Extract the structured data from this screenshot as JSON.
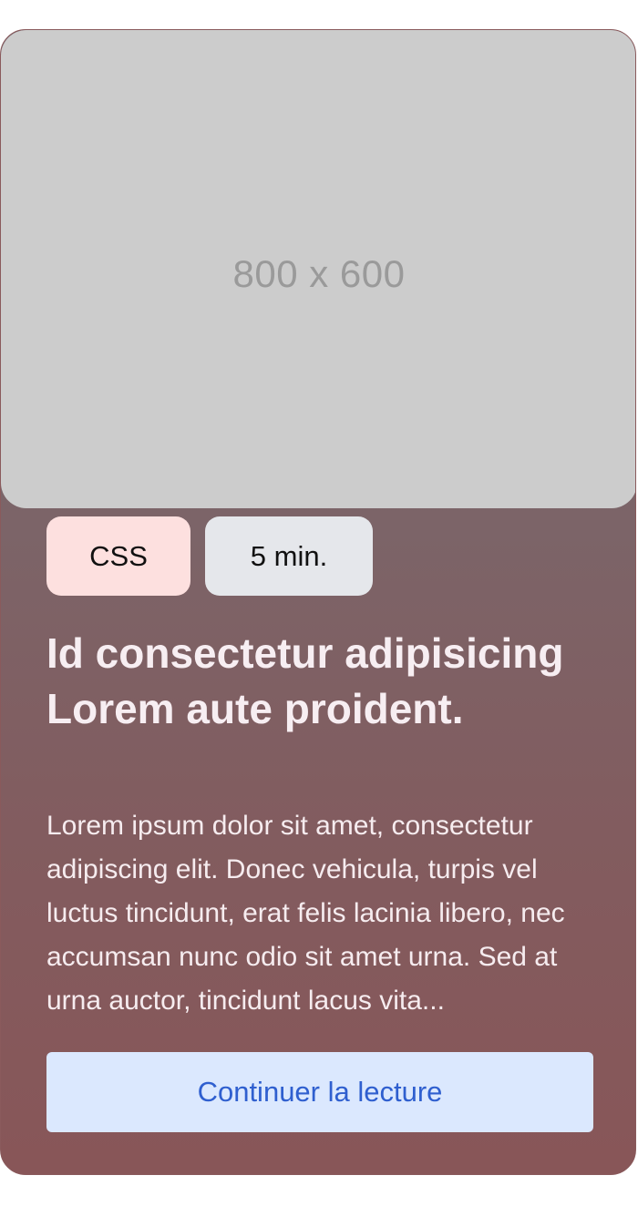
{
  "card": {
    "image_placeholder": "800 x 600",
    "tags": {
      "topic": "CSS",
      "duration": "5 min."
    },
    "title": "Id consectetur adipisicing Lorem aute proident.",
    "excerpt": "Lorem ipsum dolor sit amet, consectetur adipiscing elit. Donec vehicula, turpis vel luctus tincidunt, erat felis lacinia libero, nec accumsan nunc odio sit amet urna. Sed at urna auctor, tincidunt lacus vita...",
    "cta_label": "Continuer la lecture"
  },
  "colors": {
    "card_gradient_top": "#766871",
    "card_gradient_bottom": "#885658",
    "image_placeholder_bg": "#cccccc",
    "tag_topic_bg": "#fde0df",
    "tag_duration_bg": "#e5e7eb",
    "cta_bg": "#dbe8fe",
    "cta_text": "#2f5fcf"
  }
}
